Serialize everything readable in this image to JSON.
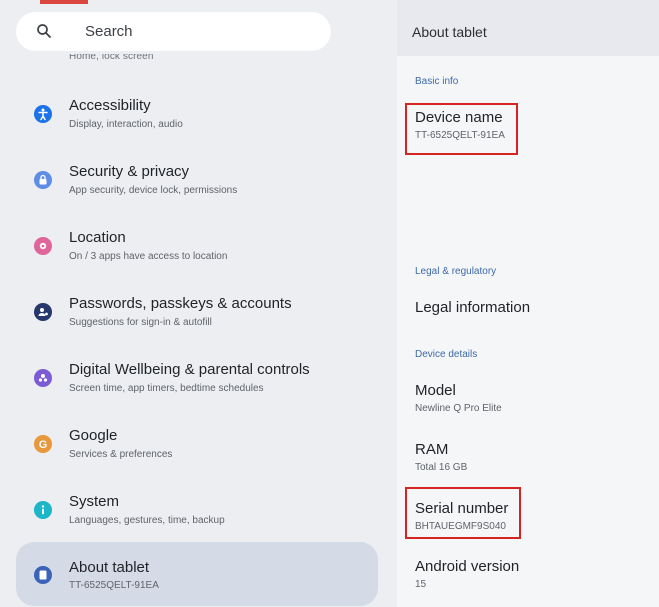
{
  "search": {
    "label": "Search"
  },
  "cut_item": "Home, lock screen",
  "settings_items": [
    {
      "id": "accessibility",
      "title": "Accessibility",
      "subtitle": "Display, interaction, audio",
      "color": "#1a73e8",
      "icon": "accessibility-icon"
    },
    {
      "id": "security",
      "title": "Security & privacy",
      "subtitle": "App security, device lock, permissions",
      "color": "#5f8de6",
      "icon": "lock-icon"
    },
    {
      "id": "location",
      "title": "Location",
      "subtitle": "On / 3 apps have access to location",
      "color": "#e0659b",
      "icon": "location-pin-icon"
    },
    {
      "id": "passwords",
      "title": "Passwords, passkeys & accounts",
      "subtitle": "Suggestions for sign-in & autofill",
      "color": "#26376e",
      "icon": "account-icon"
    },
    {
      "id": "wellbeing",
      "title": "Digital Wellbeing & parental controls",
      "subtitle": "Screen time, app timers, bedtime schedules",
      "color": "#7b5bd6",
      "icon": "wellbeing-icon"
    },
    {
      "id": "google",
      "title": "Google",
      "subtitle": "Services & preferences",
      "color": "#e8973a",
      "icon": "google-icon"
    },
    {
      "id": "system",
      "title": "System",
      "subtitle": "Languages, gestures, time, backup",
      "color": "#1db6c9",
      "icon": "info-icon"
    },
    {
      "id": "about",
      "title": "About tablet",
      "subtitle": "TT-6525QELT-91EA",
      "color": "#3b63b8",
      "icon": "tablet-icon"
    }
  ],
  "about": {
    "header": "About tablet",
    "sections": {
      "basic": "Basic info",
      "legal": "Legal & regulatory",
      "device": "Device details"
    },
    "device_name": {
      "title": "Device name",
      "value": "TT-6525QELT-91EA"
    },
    "legal_info": {
      "title": "Legal information"
    },
    "model": {
      "title": "Model",
      "value": "Newline Q Pro Elite"
    },
    "ram": {
      "title": "RAM",
      "value": "Total 16 GB"
    },
    "serial": {
      "title": "Serial number",
      "value": "BHTAUEGMF9S040"
    },
    "android": {
      "title": "Android version",
      "value": "15"
    }
  }
}
